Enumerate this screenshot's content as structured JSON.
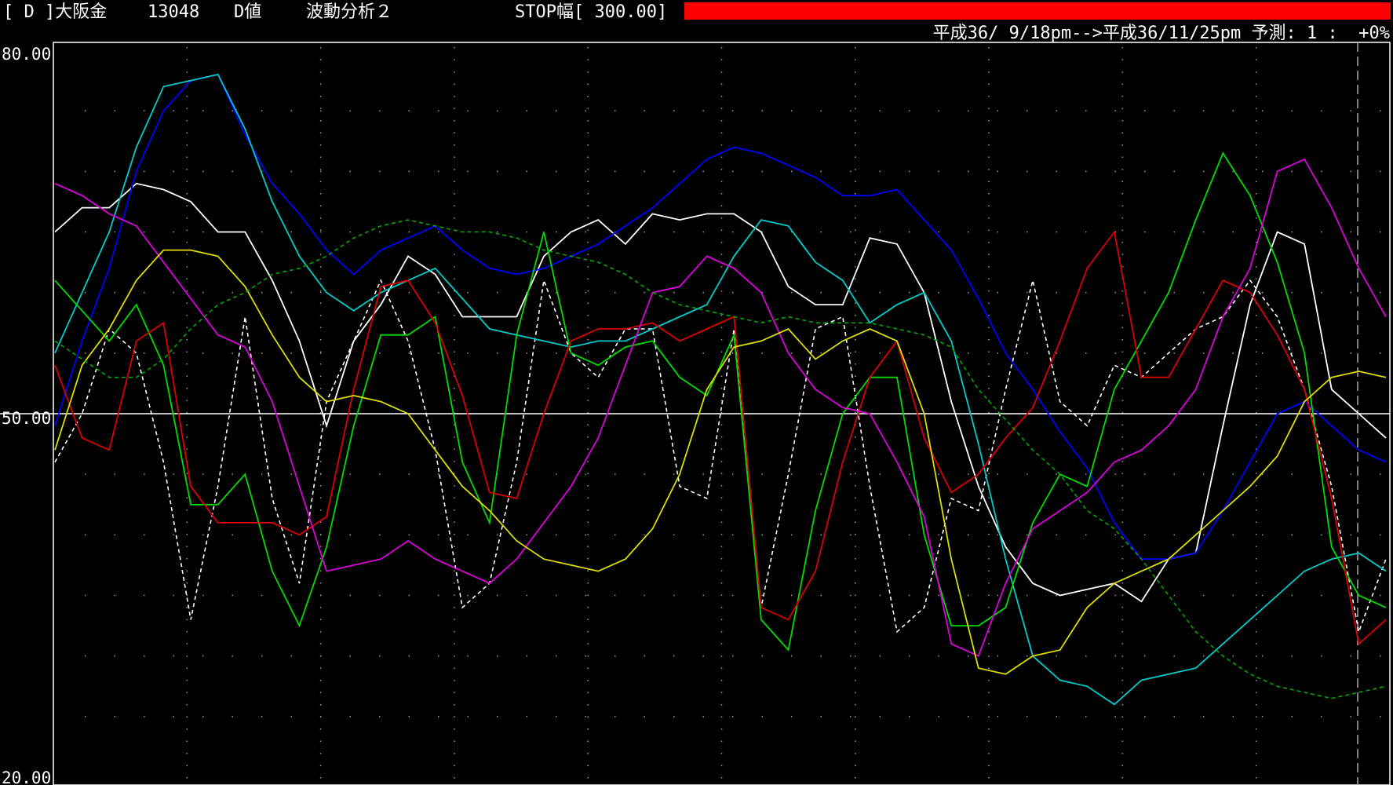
{
  "header": {
    "contract": "[ D ]大阪金",
    "code": "13048",
    "value_type": "D値",
    "analysis": "波動分析２",
    "stop_width": "STOP幅[ 300.00]",
    "stop_bar_color": "#ff0000",
    "period": "平成36/ 9/18pm-->平成36/11/25pm 予測: 1 :  +0%"
  },
  "chart_data": {
    "type": "line",
    "ylim": [
      20,
      80
    ],
    "yticks": [
      "80.00",
      "50.00",
      "20.00"
    ],
    "reference_line": 50,
    "x": [
      0,
      1,
      2,
      3,
      4,
      5,
      6,
      7,
      8,
      9,
      10,
      11,
      12,
      13,
      14,
      15,
      16,
      17,
      18,
      19,
      20,
      21,
      22,
      23,
      24,
      25,
      26,
      27,
      28,
      29,
      30,
      31,
      32,
      33,
      34,
      35,
      36,
      37,
      38,
      39,
      40,
      41,
      42,
      43,
      44,
      45,
      46,
      47,
      48,
      49
    ],
    "grid": true,
    "series": [
      {
        "color": "#ffffff",
        "style": "dashed",
        "values": [
          46,
          50,
          57,
          55,
          46,
          33,
          44,
          58,
          43,
          36,
          51,
          56,
          61,
          56,
          47,
          34,
          36,
          46,
          61,
          55,
          53,
          57,
          57,
          44,
          43,
          57,
          34,
          45,
          57,
          58,
          44,
          32,
          34,
          43,
          42,
          52,
          61,
          51,
          49,
          54,
          53,
          55,
          57,
          58,
          61,
          58,
          52,
          44,
          32,
          38
        ]
      },
      {
        "color": "#ffffff",
        "style": "solid",
        "values": [
          65,
          67,
          67,
          69,
          68.5,
          67.5,
          65,
          65,
          61,
          56,
          49,
          56,
          59,
          63,
          61.5,
          58,
          58,
          58,
          63,
          65,
          66,
          64,
          66.5,
          66,
          66.5,
          66.5,
          65,
          60.5,
          59,
          59,
          64.5,
          64,
          60,
          51,
          44,
          39,
          36,
          35,
          35.5,
          36,
          34.5,
          38,
          38.5,
          49,
          59,
          65,
          64,
          52,
          50,
          48
        ]
      },
      {
        "color": "#0000ff",
        "style": "solid",
        "values": [
          49,
          56,
          62,
          70,
          75,
          77.5,
          78,
          73,
          69,
          66.5,
          63.5,
          61.5,
          63.5,
          64.5,
          65.5,
          63.5,
          62,
          61.5,
          62,
          63,
          64,
          65.5,
          67,
          69,
          71,
          72,
          71.5,
          70.5,
          69.5,
          68,
          68,
          68.5,
          66,
          63.5,
          59.5,
          55,
          52,
          48.5,
          45.5,
          41,
          38,
          38,
          38.5,
          42,
          46,
          50,
          51,
          49,
          47,
          46
        ]
      },
      {
        "color": "#00cccc",
        "style": "solid",
        "values": [
          55,
          60,
          65,
          72,
          77,
          77.5,
          78,
          73.5,
          67.5,
          63,
          60,
          58.5,
          60,
          61,
          62,
          59.5,
          57,
          56.5,
          56,
          55.5,
          56,
          56,
          57,
          58,
          59,
          63,
          66,
          65.5,
          62.5,
          61,
          57.5,
          59,
          60,
          56,
          47.5,
          38,
          30,
          28,
          27.5,
          26,
          28,
          28.5,
          29,
          31,
          33,
          35,
          37,
          38,
          38.5,
          37
        ]
      },
      {
        "color": "#00dd00",
        "style": "solid",
        "values": [
          61,
          58.5,
          56,
          59,
          54,
          42.5,
          42.5,
          45,
          37,
          32.5,
          39,
          49,
          56.5,
          56.5,
          58,
          46,
          41,
          56.5,
          65,
          55,
          54,
          55.5,
          56,
          53,
          51.5,
          56.5,
          33,
          30.5,
          42,
          50,
          53,
          53,
          40,
          32.5,
          32.5,
          34,
          41,
          45,
          44,
          52,
          56,
          60,
          66,
          71.5,
          68,
          62.5,
          55,
          39,
          35,
          34
        ]
      },
      {
        "color": "#dd0000",
        "style": "solid",
        "values": [
          54,
          48,
          47,
          56,
          57.5,
          44,
          41,
          41,
          41,
          40,
          41.5,
          52,
          60.5,
          61,
          57.5,
          51.5,
          43.5,
          43,
          50,
          56,
          57,
          57,
          57.5,
          56,
          57,
          58,
          34,
          33,
          37,
          46,
          53,
          56,
          48,
          43.5,
          45,
          48,
          50.5,
          56,
          62,
          65,
          53,
          53,
          57,
          61,
          60,
          56.5,
          52,
          43,
          31,
          33
        ]
      },
      {
        "color": "#dd00dd",
        "style": "solid",
        "values": [
          69,
          68,
          66.5,
          65.5,
          62.5,
          59.5,
          56.5,
          55.5,
          51,
          44,
          37,
          37.5,
          38,
          39.5,
          38,
          37,
          36,
          38,
          41,
          44,
          48,
          54,
          60,
          60.5,
          63,
          62,
          60,
          55,
          52,
          50.5,
          50,
          46,
          41.5,
          31,
          30,
          36,
          40.5,
          42,
          43.5,
          46,
          47,
          49,
          52,
          58,
          62,
          70,
          71,
          67,
          62,
          58
        ]
      },
      {
        "color": "#dddd00",
        "style": "solid",
        "values": [
          47,
          54,
          57,
          61,
          63.5,
          63.5,
          63,
          60.5,
          56.5,
          53,
          51,
          51.5,
          51,
          50,
          47,
          44,
          42,
          39.5,
          38,
          37.5,
          37,
          38,
          40.5,
          45,
          52,
          55.5,
          56,
          57,
          54.5,
          56,
          57,
          56,
          50,
          38,
          29,
          28.5,
          30,
          30.5,
          34,
          36,
          37,
          38,
          40,
          42,
          44,
          46.5,
          51,
          53,
          53.5,
          53
        ]
      },
      {
        "color": "#00aa00",
        "style": "dashed",
        "values": [
          56,
          54.5,
          53,
          53,
          54.5,
          57,
          59,
          60,
          61.5,
          62,
          63,
          64.5,
          65.5,
          66,
          65.5,
          65,
          65,
          64.5,
          63.5,
          63,
          62.5,
          61.5,
          60,
          59,
          58.5,
          58,
          57.5,
          58,
          57.5,
          57.5,
          57.5,
          57,
          56.5,
          55.5,
          52,
          49.5,
          47,
          45,
          42,
          40.5,
          38,
          35,
          32,
          30,
          28.5,
          27.5,
          27,
          26.5,
          27,
          27.5
        ]
      }
    ]
  }
}
